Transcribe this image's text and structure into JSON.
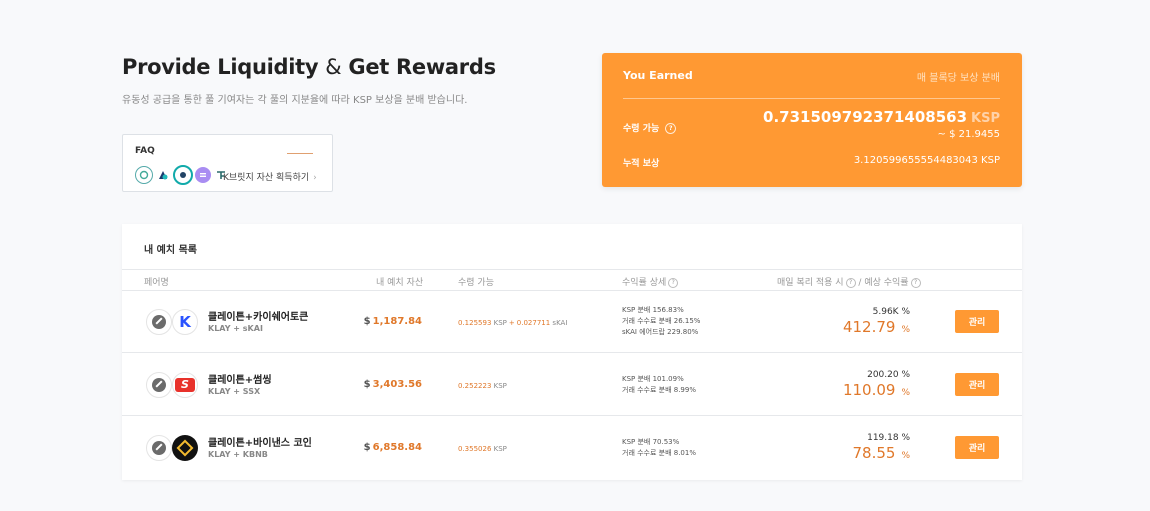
{
  "hero": {
    "title_part1": "Provide Liquidity",
    "title_amp": "&",
    "title_part2": "Get Rewards",
    "subtitle": "유동성 공급을 통한 풀 기여자는 각 풀의 지분율에 따라 KSP 보상을 분배 받습니다."
  },
  "faq": {
    "title": "FAQ",
    "link_label": "K브릿지 자산 획득하기",
    "chevron": "›",
    "icons": [
      "token-icon-1",
      "token-icon-2",
      "token-icon-3",
      "token-icon-4",
      "token-icon-5"
    ]
  },
  "earned": {
    "title": "You Earned",
    "per_block_label": "매 블록당 보상 분배",
    "claimable_label": "수령 가능",
    "claimable_amount": "0.731509792371408563",
    "claimable_unit": "KSP",
    "claimable_usd": "~ $ 21.9455",
    "accumulated_label": "누적 보상",
    "accumulated_amount": "3.120599655554483043 KSP"
  },
  "deposits": {
    "title": "내 예치 목록",
    "headers": {
      "pair": "페어명",
      "asset": "내 예치 자산",
      "claimable": "수령 가능",
      "detail": "수익률 상세",
      "apr": "매일 복리 적용 시",
      "expected": "/ 예상 수익률"
    },
    "rows": [
      {
        "name": "클레이튼+카이쉐어토큰",
        "symbol": "KLAY + sKAI",
        "asset_symbol": "$",
        "asset_value": "1,187.84",
        "claim_1": "0.125593",
        "claim_1_unit": "KSP",
        "claim_plus": "+",
        "claim_2": "0.027711",
        "claim_2_unit": "sKAI",
        "detail_lines": [
          "KSP 분배 156.83%",
          "거래 수수료 분배 26.15%",
          "sKAI 에어드랍 229.80%"
        ],
        "apr_compound": "5.96K %",
        "apr_expected": "412.79",
        "apr_unit": "%",
        "button": "관리"
      },
      {
        "name": "클레이튼+썸씽",
        "symbol": "KLAY + SSX",
        "asset_symbol": "$",
        "asset_value": "3,403.56",
        "claim_1": "0.252223",
        "claim_1_unit": "KSP",
        "detail_lines": [
          "KSP 분배 101.09%",
          "거래 수수료 분배 8.99%"
        ],
        "apr_compound": "200.20 %",
        "apr_expected": "110.09",
        "apr_unit": "%",
        "button": "관리"
      },
      {
        "name": "클레이튼+바이낸스 코인",
        "symbol": "KLAY + KBNB",
        "asset_symbol": "$",
        "asset_value": "6,858.84",
        "claim_1": "0.355026",
        "claim_1_unit": "KSP",
        "detail_lines": [
          "KSP 분배 70.53%",
          "거래 수수료 분배 8.01%"
        ],
        "apr_compound": "119.18 %",
        "apr_expected": "78.55",
        "apr_unit": "%",
        "button": "관리"
      }
    ]
  },
  "colors": {
    "accent": "#ff9933",
    "value_orange": "#e0782a",
    "background": "#f8f9fb"
  }
}
